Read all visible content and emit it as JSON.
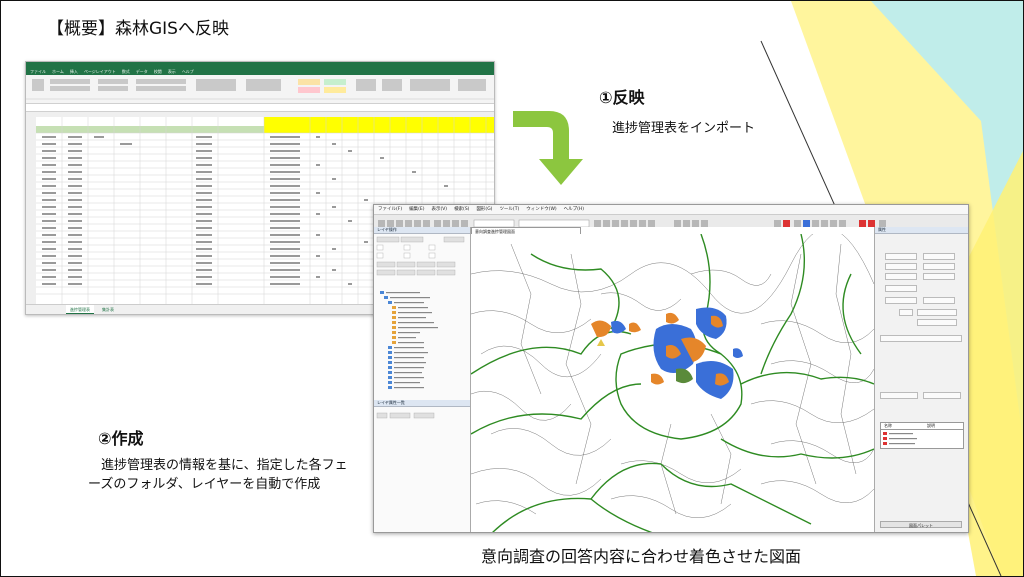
{
  "title": "【概要】森林GISへ反映",
  "step1": {
    "heading": "①反映",
    "description": "進捗管理表をインポート"
  },
  "step2": {
    "heading": "②作成",
    "description": "進捗管理表の情報を基に、指定した各フェーズのフォルダ、レイヤーを自動で作成"
  },
  "caption": "意向調査の回答内容に合わせ着色させた図面",
  "colors": {
    "arrow": "#8cc63f",
    "accent_yellow": "#fff176",
    "accent_cyan": "#b2ebf2",
    "excel_green": "#217346",
    "map_line": "#2e8b22",
    "map_blue": "#3a6fd8",
    "map_orange": "#e5862a"
  },
  "excel": {
    "menu": [
      "ファイル",
      "ホーム",
      "挿入",
      "ページレイアウト",
      "数式",
      "データ",
      "校閲",
      "表示",
      "ヘルプ"
    ],
    "sheet_tabs": [
      "進捗管理表",
      "集計表"
    ]
  },
  "gis": {
    "menu": [
      "ファイル(F)",
      "編集(E)",
      "表示(V)",
      "検索(S)",
      "図形(G)",
      "ツール(T)",
      "ウィンドウ(W)",
      "ヘルプ(H)"
    ],
    "layer_panel_title": "レイヤ操作",
    "attr_panel_title": "レイヤ属性一覧",
    "map_tab": "意向調査進捗管理図面",
    "right_panel_title": "属性",
    "legend_header": [
      "名称",
      "説明"
    ],
    "bottom_tab": "図面パレット"
  }
}
